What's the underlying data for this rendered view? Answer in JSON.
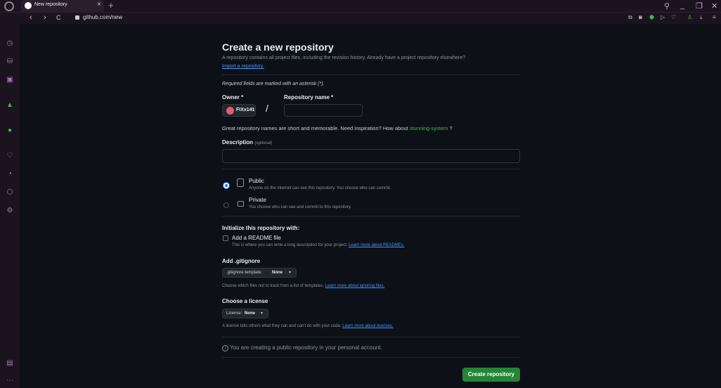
{
  "browser": {
    "tab_title": "New repository",
    "tab_close": "×",
    "new_tab": "+",
    "url": "github.com/new",
    "back": "‹",
    "forward": "›",
    "reload": "C"
  },
  "page": {
    "title": "Create a new repository",
    "intro": "A repository contains all project files, including the revision history. Already have a project repository elsewhere?",
    "import_link": "Import a repository.",
    "required_note": "Required fields are marked with an asterisk (*).",
    "owner_label": "Owner *",
    "repo_name_label": "Repository name *",
    "owner_value": "FIXx141",
    "slash": "/",
    "repo_name_value": "",
    "suggestion_text": "Great repository names are short and memorable. Need inspiration? How about",
    "suggestion_name": "stunning-system",
    "suggestion_end": "?",
    "description_label": "Description",
    "description_optional": "(optional)",
    "description_value": "",
    "public_label": "Public",
    "public_desc": "Anyone on the internet can see this repository. You choose who can commit.",
    "private_label": "Private",
    "private_desc": "You choose who can see and commit to this repository.",
    "init_heading": "Initialize this repository with:",
    "readme_label": "Add a README file",
    "readme_desc": "This is where you can write a long description for your project.",
    "readme_link": "Learn more about READMEs.",
    "gitignore_heading": "Add .gitignore",
    "gitignore_button_prefix": ".gitignore template:",
    "gitignore_button_value": "None",
    "gitignore_desc": "Choose which files not to track from a list of templates.",
    "gitignore_link": "Learn more about ignoring files.",
    "license_heading": "Choose a license",
    "license_button_prefix": "License:",
    "license_button_value": "None",
    "license_desc": "A license tells others what they can and can't do with your code.",
    "license_link": "Learn more about licenses.",
    "info_note": "You are creating a public repository in your personal account.",
    "create_button": "Create repository"
  },
  "colors": {
    "accent_link": "#4493f8",
    "suggestion": "#3fb950",
    "create_button": "#238636",
    "radio_selected": "#1f6feb"
  }
}
